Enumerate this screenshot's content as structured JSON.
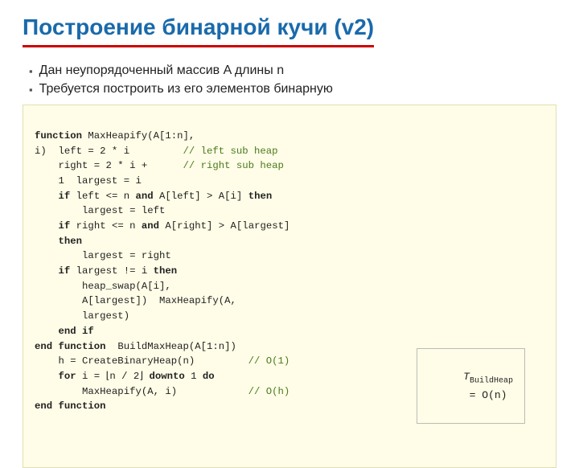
{
  "slide": {
    "title": "Построение бинарной кучи (v2)",
    "bullets": [
      "Дан неупорядоченный массив A длины n",
      "Требуется построить из его элементов бинарную"
    ],
    "code": {
      "lines": [
        {
          "indent": 0,
          "text": "function MaxHeapify(A[1:n],"
        },
        {
          "indent": 0,
          "text": "i)  left = 2 * i         // left sub heap"
        },
        {
          "indent": 1,
          "text": "right = 2 * i +      // right sub heap"
        },
        {
          "indent": 1,
          "text": "1  largest = i"
        },
        {
          "indent": 1,
          "text": "if left <= n and A[left] > A[i] then"
        },
        {
          "indent": 2,
          "text": "largest = left"
        },
        {
          "indent": 1,
          "text": "if right <= n and A[right] > A[largest]"
        },
        {
          "indent": 1,
          "text": "then"
        },
        {
          "indent": 2,
          "text": "largest = right"
        },
        {
          "indent": 1,
          "text": "if largest != i then"
        },
        {
          "indent": 2,
          "text": "heap_swap(A[i],"
        },
        {
          "indent": 2,
          "text": "A[largest])  MaxHeapify(A,"
        },
        {
          "indent": 2,
          "text": "largest)"
        },
        {
          "indent": 1,
          "text": "end if"
        },
        {
          "indent": 0,
          "text": "end function  BuildMaxHeap(A[1:n])"
        },
        {
          "indent": 1,
          "text": "h = CreateBinaryHeap(n)         // O(1)"
        },
        {
          "indent": 1,
          "text": "for i = |n / 2| downto 1 do"
        },
        {
          "indent": 2,
          "text": "MaxHeapify(A, i)                // O(h)"
        },
        {
          "indent": 0,
          "text": "end function"
        }
      ]
    },
    "complexity": {
      "label": "T",
      "subscript": "BuildHeap",
      "value": "= O(n)"
    }
  }
}
